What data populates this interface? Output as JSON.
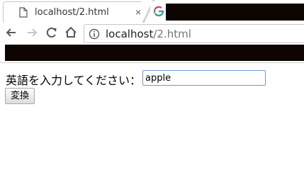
{
  "tabs": [
    {
      "title": "localhost/2.html",
      "close": "×",
      "icon": "document-icon",
      "active": true
    },
    {
      "title": "",
      "icon": "google-icon",
      "active": false
    }
  ],
  "toolbar": {
    "back_icon": "back-arrow-icon",
    "forward_icon": "forward-arrow-icon",
    "reload_icon": "reload-icon",
    "home_icon": "home-icon",
    "site_info_icon": "info-icon",
    "url_host": "localhost",
    "url_path": "/2.html"
  },
  "page": {
    "prompt_label": "英語を入力してください：",
    "input_value": "apple",
    "convert_label": "変換"
  },
  "colors": {
    "redaction": "#0e0400",
    "input_focus_border": "#6a9ad8"
  }
}
